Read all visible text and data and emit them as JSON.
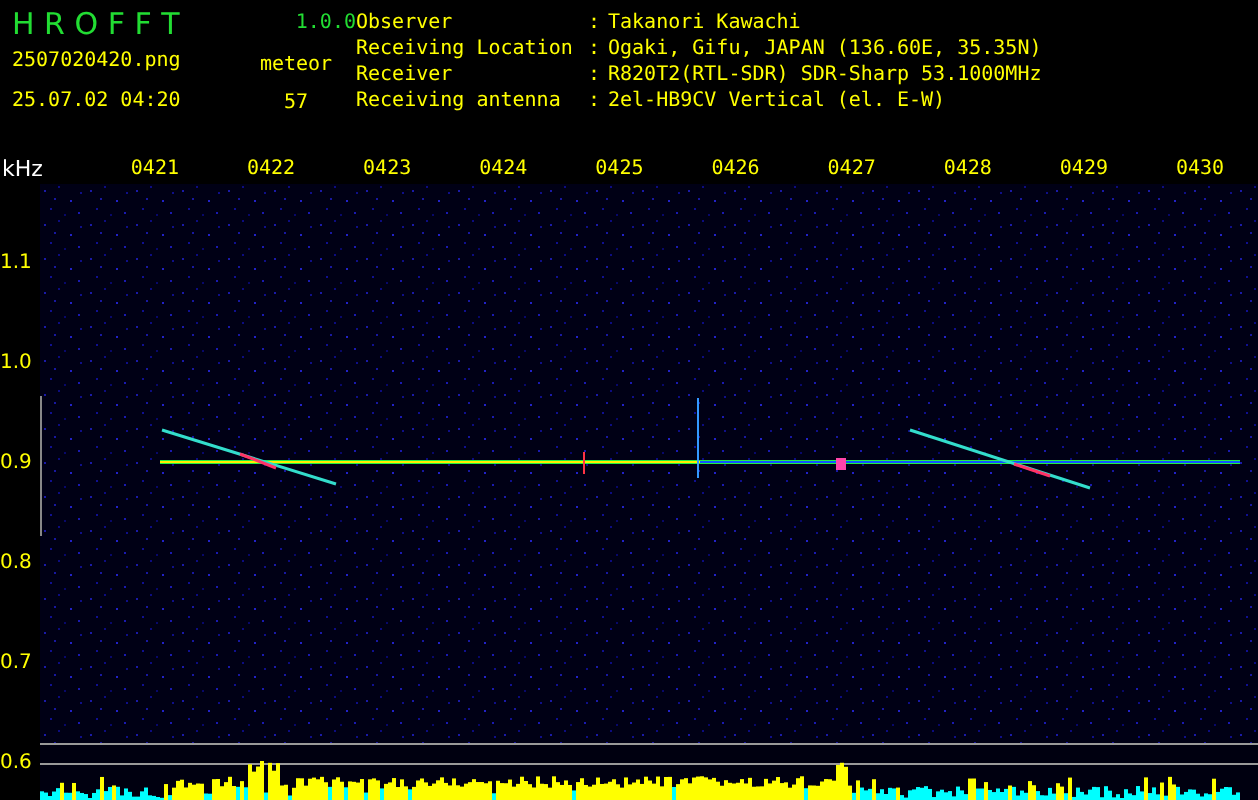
{
  "app": {
    "name": "H R O F F T",
    "version": "1.0.0"
  },
  "file": {
    "name": "2507020420.png",
    "timestamp": "25.07.02 04:20"
  },
  "count": {
    "label": "meteor",
    "value": "57"
  },
  "station": [
    {
      "label": "Observer",
      "separator": ":",
      "value": "Takanori Kawachi"
    },
    {
      "label": "Receiving Location",
      "separator": ":",
      "value": "Ogaki, Gifu, JAPAN (136.60E, 35.35N)"
    },
    {
      "label": "Receiver",
      "separator": ":",
      "value": "R820T2(RTL-SDR) SDR-Sharp 53.1000MHz"
    },
    {
      "label": "Receiving antenna",
      "separator": ":",
      "value": "2el-HB9CV Vertical (el. E-W)"
    }
  ],
  "spectrogram": {
    "y_unit": "kHz",
    "x_ticks": [
      "0421",
      "0422",
      "0423",
      "0424",
      "0425",
      "0426",
      "0427",
      "0428",
      "0429",
      "0430"
    ],
    "y_ticks": [
      "1.1",
      "1.0",
      "0.9",
      "0.8",
      "0.7",
      "0.6"
    ]
  }
}
